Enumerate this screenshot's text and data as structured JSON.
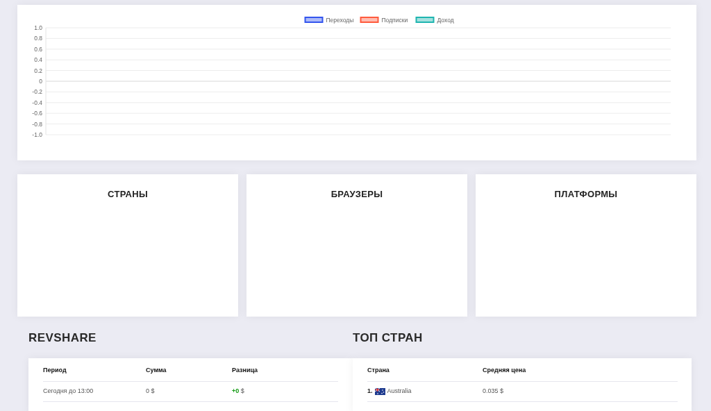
{
  "traffic_chart": {
    "chart_data": {
      "type": "line",
      "grid": true,
      "series": [
        {
          "name": "Переходы",
          "color": "#3355ee"
        },
        {
          "name": "Подписки",
          "color": "#ff5a3c"
        },
        {
          "name": "Доход",
          "color": "#1fb5b0"
        }
      ],
      "ylim": [
        -1,
        1
      ],
      "yticks": [
        {
          "value": 1,
          "label": "1.0"
        },
        {
          "value": 0.8,
          "label": "0.8"
        },
        {
          "value": 0.6,
          "label": "0.6"
        },
        {
          "value": 0.4,
          "label": "0.4"
        },
        {
          "value": 0.2,
          "label": "0.2"
        },
        {
          "value": 0,
          "label": "0"
        },
        {
          "value": -0.2,
          "label": "-0.2"
        },
        {
          "value": -0.4,
          "label": "-0.4"
        },
        {
          "value": -0.6,
          "label": "-0.6"
        },
        {
          "value": -0.8,
          "label": "-0.8"
        },
        {
          "value": -1,
          "label": "-1.0"
        }
      ]
    }
  },
  "panels": [
    {
      "title": "СТРАНЫ"
    },
    {
      "title": "БРАУЗЕРЫ"
    },
    {
      "title": "ПЛАТФОРМЫ"
    }
  ],
  "revshare": {
    "title": "REVSHARE",
    "columns": [
      "Период",
      "Сумма",
      "Разница"
    ],
    "rows": [
      {
        "period": "Сегодня до 13:00",
        "amount": "0",
        "currency": "$",
        "difference": "+0",
        "difference_currency": "$"
      }
    ]
  },
  "top_countries": {
    "title": "ТОП СТРАН",
    "columns": [
      "Страна",
      "Средняя цена"
    ],
    "rows": [
      {
        "rank": "1.",
        "country": "Australia",
        "price": "0.035",
        "currency": "$"
      }
    ]
  }
}
